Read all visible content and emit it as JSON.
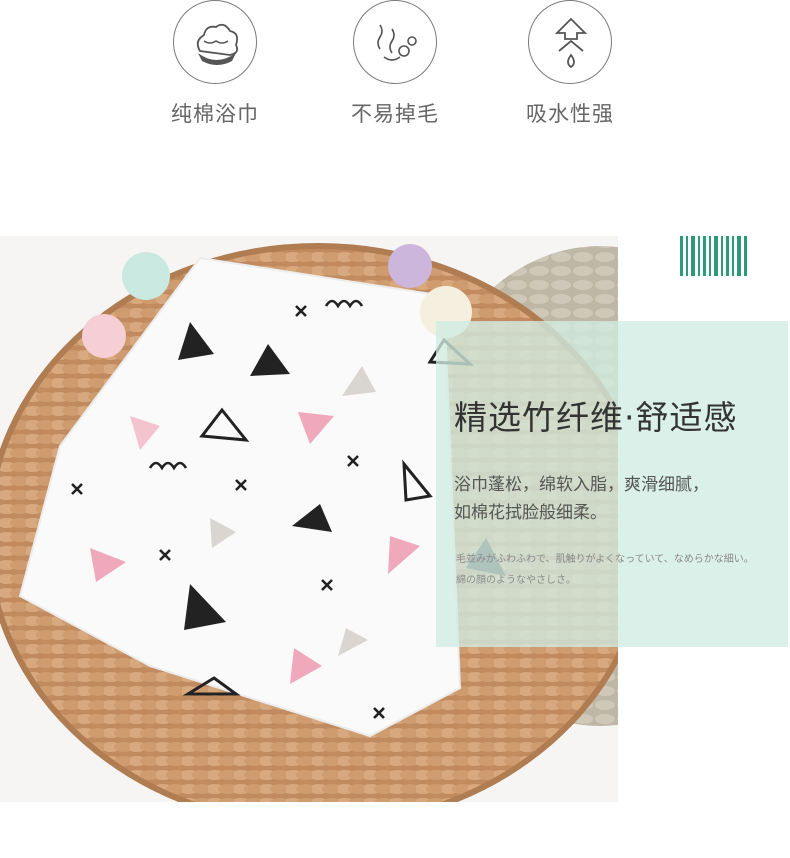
{
  "features": [
    {
      "icon": "cotton-icon",
      "label": "纯棉浴巾"
    },
    {
      "icon": "no-lint-icon",
      "label": "不易掉毛"
    },
    {
      "icon": "absorb-water-icon",
      "label": "吸水性强"
    }
  ],
  "panel": {
    "headline": "精选竹纤维·舒适感",
    "desc_line1": "浴巾蓬松，绵软入脂，爽滑细腻，",
    "desc_line2": "如棉花拭脸般细柔。",
    "small_line1": "毛並みがふわふわで、肌触りがよくなっていて、なめらかな細い。",
    "small_line2": "綿の顔のようなやさしさ。"
  },
  "colors": {
    "accent_green": "#2f9a7a",
    "panel_bg": "#d0ece2",
    "rattan": "#c9946a"
  }
}
